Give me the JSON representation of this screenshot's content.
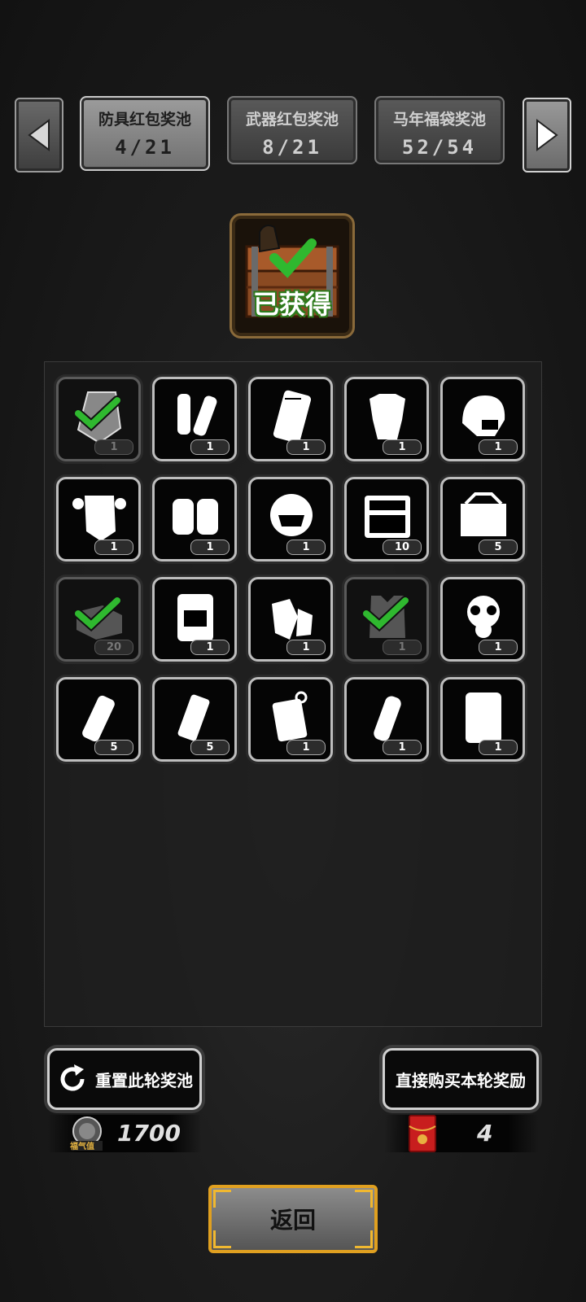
{
  "tabs": [
    {
      "name": "防具红包奖池",
      "count": "4/21",
      "active": true
    },
    {
      "name": "武器红包奖池",
      "count": "8/21",
      "active": false
    },
    {
      "name": "马年福袋奖池",
      "count": "52/54",
      "active": false
    }
  ],
  "chest": {
    "status": "已获得"
  },
  "items": [
    {
      "icon": "riot-shield-icon",
      "qty": "1",
      "obtained": true
    },
    {
      "icon": "shin-guards-icon",
      "qty": "1",
      "obtained": false
    },
    {
      "icon": "ballistic-plate-icon",
      "qty": "1",
      "obtained": false
    },
    {
      "icon": "body-armor-icon",
      "qty": "1",
      "obtained": false
    },
    {
      "icon": "tactical-helmet-icon",
      "qty": "1",
      "obtained": false
    },
    {
      "icon": "armored-suit-icon",
      "qty": "1",
      "obtained": false
    },
    {
      "icon": "knee-pads-icon",
      "qty": "1",
      "obtained": false
    },
    {
      "icon": "full-helmet-icon",
      "qty": "1",
      "obtained": false
    },
    {
      "icon": "repair-kit-icon",
      "qty": "10",
      "obtained": false
    },
    {
      "icon": "toolbox-icon",
      "qty": "5",
      "obtained": false
    },
    {
      "icon": "open-box-icon",
      "qty": "20",
      "obtained": true
    },
    {
      "icon": "backpack-icon",
      "qty": "1",
      "obtained": false
    },
    {
      "icon": "gloves-icon",
      "qty": "1",
      "obtained": false
    },
    {
      "icon": "tactical-vest-icon",
      "qty": "1",
      "obtained": true
    },
    {
      "icon": "gas-mask-icon",
      "qty": "1",
      "obtained": false
    },
    {
      "icon": "flashbang-icon",
      "qty": "5",
      "obtained": false
    },
    {
      "icon": "smoke-grenade-icon",
      "qty": "5",
      "obtained": false
    },
    {
      "icon": "incendiary-grenade-icon",
      "qty": "1",
      "obtained": false
    },
    {
      "icon": "stun-grenade-icon",
      "qty": "1",
      "obtained": false
    },
    {
      "icon": "perforated-plate-icon",
      "qty": "1",
      "obtained": false
    }
  ],
  "buttons": {
    "reset": "重置此轮奖池",
    "buy": "直接购买本轮奖励",
    "back": "返回"
  },
  "currency": {
    "fortune_value": "1700",
    "fortune_label": "福气值",
    "envelope_count": "4"
  },
  "colors": {
    "check_green": "#2fb82f",
    "gold_frame": "#e0a020",
    "obtained_border": "#5a5a5a"
  }
}
